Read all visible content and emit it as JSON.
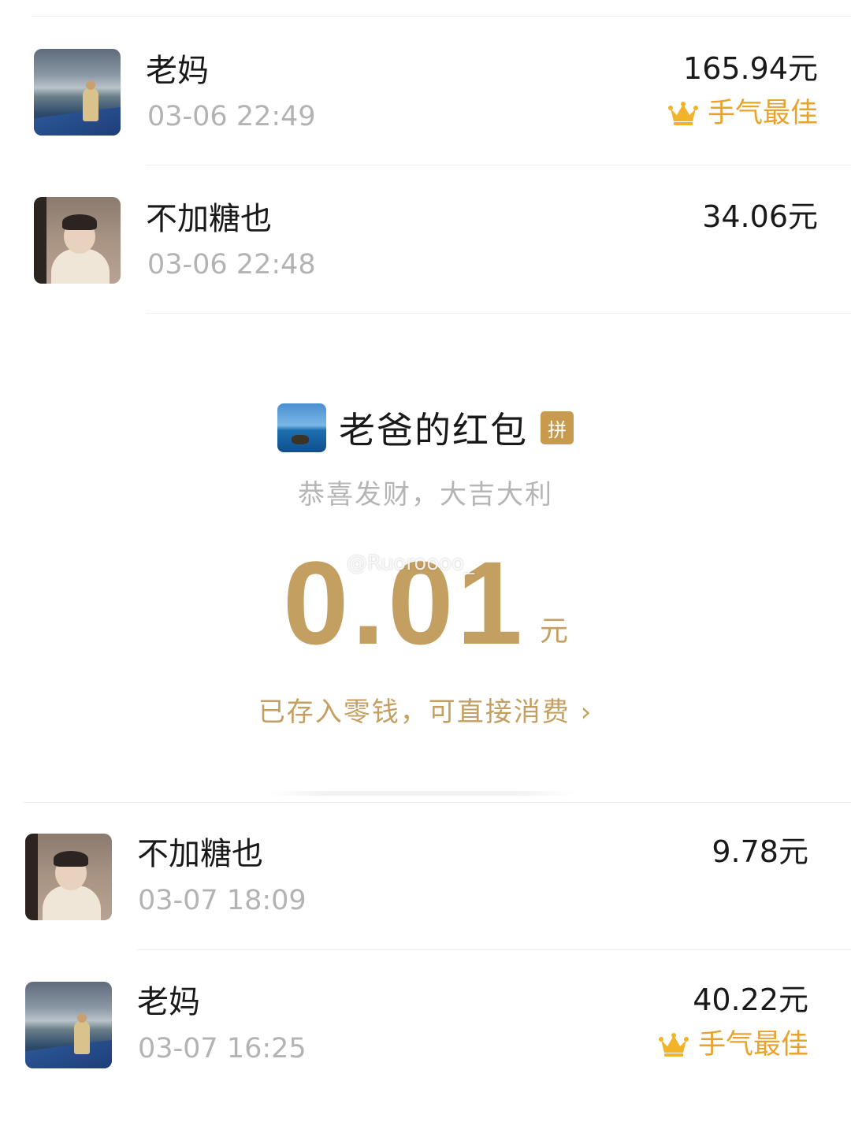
{
  "records_top": [
    {
      "name": "老妈",
      "time": "03-06 22:49",
      "amount": "165.94元",
      "best": "手气最佳",
      "avatar": "lake-icon"
    },
    {
      "name": "不加糖也",
      "time": "03-06 22:48",
      "amount": "34.06元",
      "best": "",
      "avatar": "child-photo-icon"
    }
  ],
  "packet": {
    "title": "老爸的红包",
    "badge": "拼",
    "wish": "恭喜发财，大吉大利",
    "amount": "0.01",
    "unit": "元",
    "link": "已存入零钱，可直接消费 ›",
    "watermark": "@Ruoroooo_"
  },
  "records_bottom": [
    {
      "name": "不加糖也",
      "time": "03-07 18:09",
      "amount": "9.78元",
      "best": "",
      "avatar": "child-photo-icon"
    },
    {
      "name": "老妈",
      "time": "03-07 16:25",
      "amount": "40.22元",
      "best": "手气最佳",
      "avatar": "lake-icon"
    }
  ],
  "colors": {
    "gold": "#c49f62",
    "best_orange": "#e9a22c",
    "muted_gray": "#b3b3b3"
  }
}
